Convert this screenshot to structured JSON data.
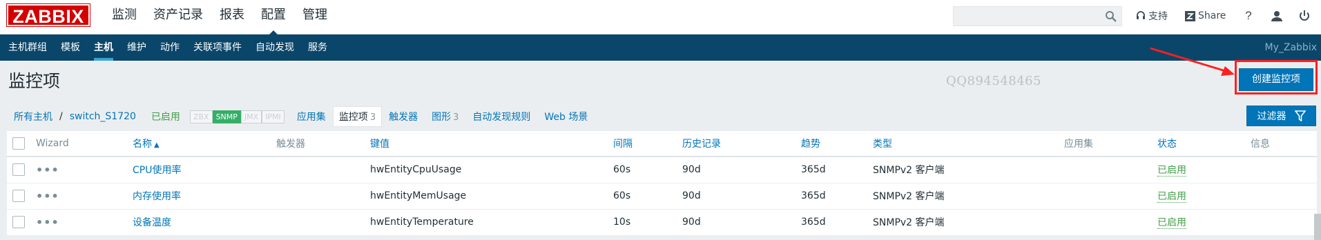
{
  "logo": "ZABBIX",
  "top_menu": [
    {
      "label": "监测",
      "selected": false
    },
    {
      "label": "资产记录",
      "selected": false
    },
    {
      "label": "报表",
      "selected": false
    },
    {
      "label": "配置",
      "selected": true
    },
    {
      "label": "管理",
      "selected": false
    }
  ],
  "search": {
    "value": "",
    "placeholder": ""
  },
  "topbar_links": {
    "support": "支持",
    "share": "Share"
  },
  "sub_menu": [
    {
      "label": "主机群组",
      "selected": false
    },
    {
      "label": "模板",
      "selected": false
    },
    {
      "label": "主机",
      "selected": true
    },
    {
      "label": "维护",
      "selected": false
    },
    {
      "label": "动作",
      "selected": false
    },
    {
      "label": "关联项事件",
      "selected": false
    },
    {
      "label": "自动发现",
      "selected": false
    },
    {
      "label": "服务",
      "selected": false
    }
  ],
  "server_name": "My_Zabbix",
  "page_title": "监控项",
  "watermark": "QQ894548465",
  "create_button": "创建监控项",
  "filter_button": "过滤器",
  "breadcrumb": {
    "all_hosts": "所有主机",
    "separator": "/",
    "host": "switch_S1720",
    "status": "已启用",
    "availability": [
      "ZBX",
      "SNMP",
      "JMX",
      "IPMI"
    ],
    "availability_active": "SNMP",
    "tabs": [
      {
        "label": "应用集",
        "count": ""
      },
      {
        "label": "监控项",
        "count": "3"
      },
      {
        "label": "触发器",
        "count": ""
      },
      {
        "label": "图形",
        "count": "3"
      },
      {
        "label": "自动发现规则",
        "count": ""
      },
      {
        "label": "Web 场景",
        "count": ""
      }
    ]
  },
  "table": {
    "headers": {
      "wizard": "Wizard",
      "name": "名称",
      "triggers": "触发器",
      "key": "键值",
      "interval": "间隔",
      "history": "历史记录",
      "trends": "趋势",
      "type": "类型",
      "applications": "应用集",
      "status": "状态",
      "info": "信息"
    },
    "rows": [
      {
        "name": "CPU使用率",
        "key": "hwEntityCpuUsage",
        "interval": "60s",
        "history": "90d",
        "trends": "365d",
        "type": "SNMPv2 客户端",
        "status": "已启用"
      },
      {
        "name": "内存使用率",
        "key": "hwEntityMemUsage",
        "interval": "60s",
        "history": "90d",
        "trends": "365d",
        "type": "SNMPv2 客户端",
        "status": "已启用"
      },
      {
        "name": "设备温度",
        "key": "hwEntityTemperature",
        "interval": "10s",
        "history": "90d",
        "trends": "365d",
        "type": "SNMPv2 客户端",
        "status": "已启用"
      }
    ]
  },
  "colors": {
    "brand_red": "#d40000",
    "nav_blue": "#0a466a",
    "link_blue": "#0275b8",
    "enabled_green": "#429e47",
    "annotation_red": "#ff1f1f"
  }
}
